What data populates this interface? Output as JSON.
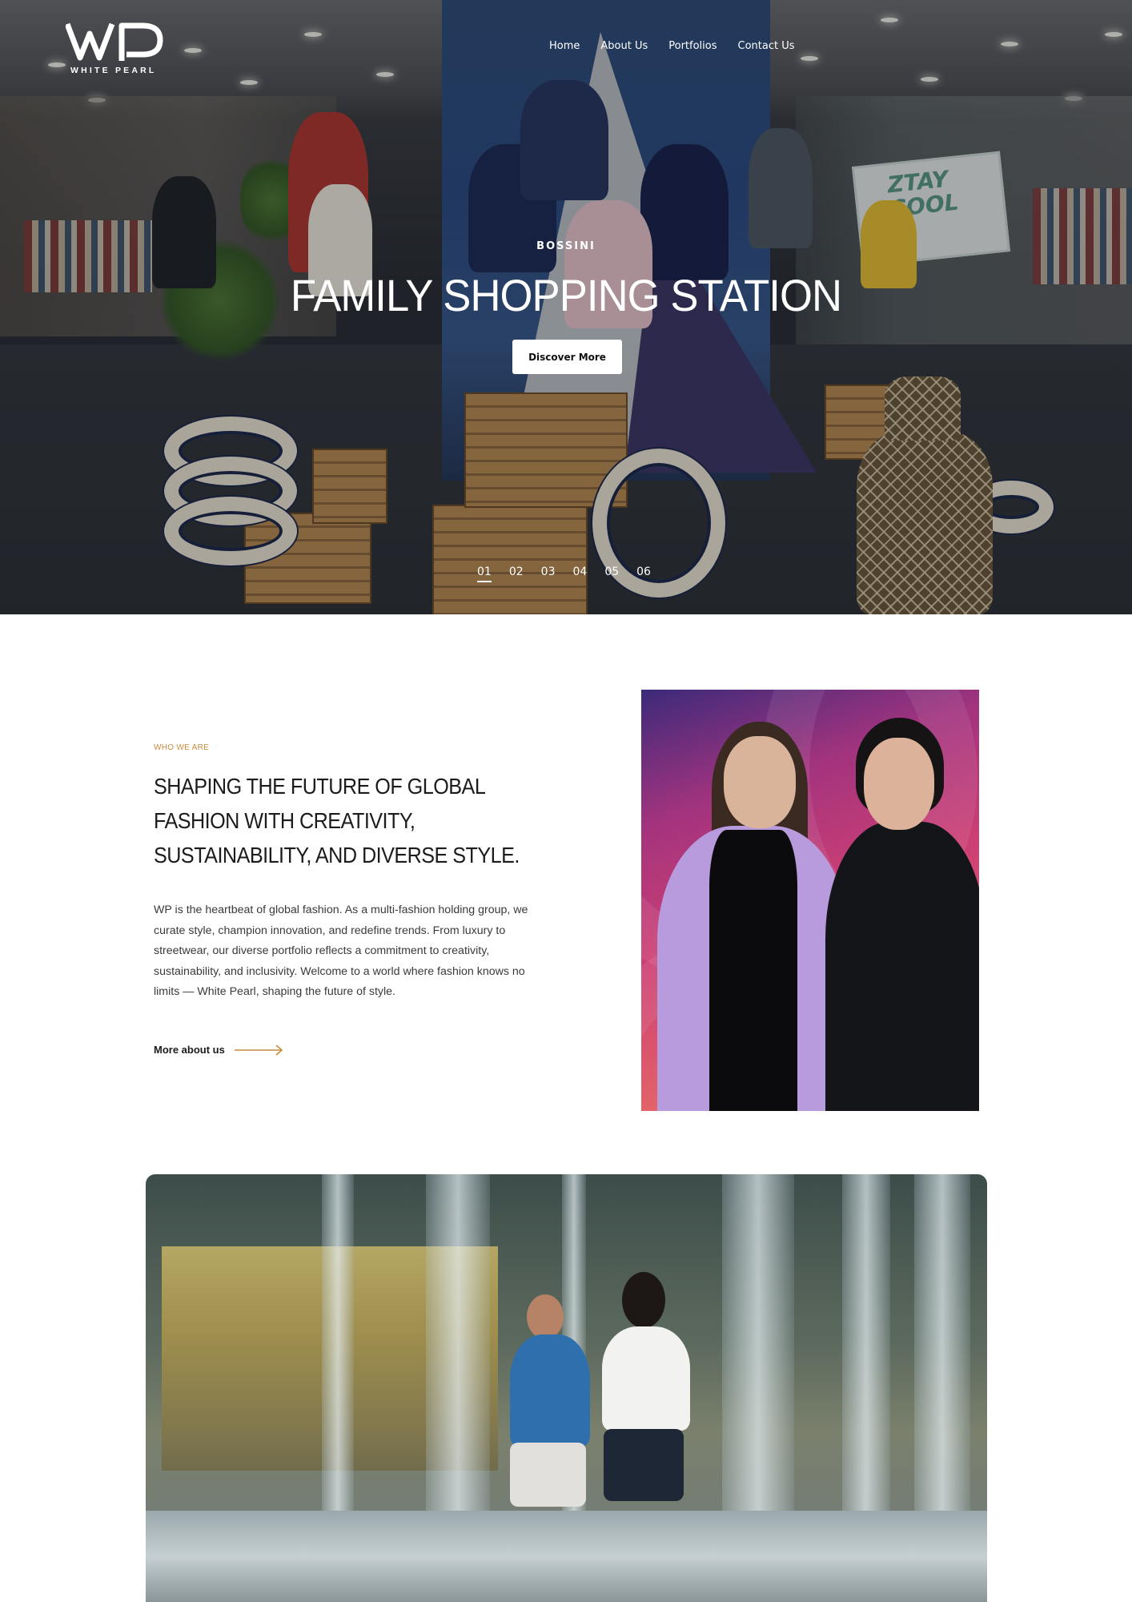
{
  "brand": {
    "logo_mark": "WP",
    "logo_text": "WHITE PEARL"
  },
  "nav": {
    "items": [
      "Home",
      "About Us",
      "Portfolios",
      "Contact Us"
    ]
  },
  "hero": {
    "kicker": "BOSSINI",
    "title": "FAMILY SHOPPING STATION",
    "cta_label": "Discover More",
    "slides": [
      "01",
      "02",
      "03",
      "04",
      "05",
      "06"
    ],
    "active_slide": "01"
  },
  "about": {
    "kicker": "WHO WE ARE",
    "title": "SHAPING THE FUTURE OF GLOBAL FASHION WITH CREATIVITY, SUSTAINABILITY, AND DIVERSE STYLE.",
    "body": "WP is the heartbeat of global fashion. As a multi-fashion holding group, we curate style, champion innovation, and redefine trends. From luxury to streetwear, our diverse portfolio reflects a commitment to creativity, sustainability, and inclusivity. Welcome to a world where fashion knows no limits — White Pearl, shaping the future of style.",
    "link_label": "More about us"
  },
  "colors": {
    "accent": "#c98a3d",
    "text_dark": "#1c1c1c",
    "background": "#ffffff"
  }
}
